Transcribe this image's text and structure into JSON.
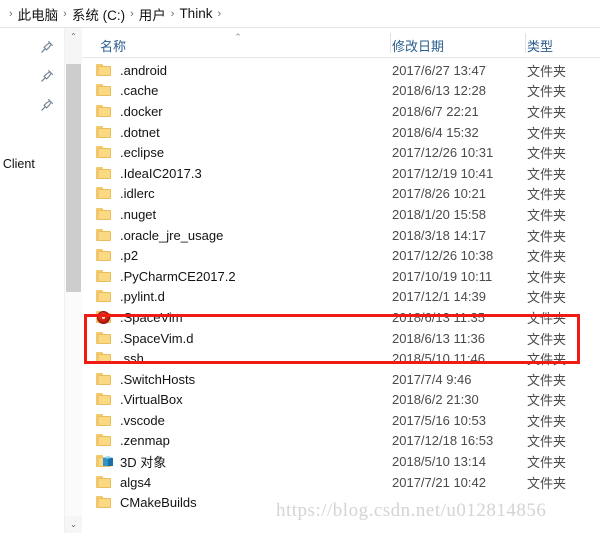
{
  "breadcrumb": {
    "separator": "›",
    "items": [
      "此电脑",
      "系统 (C:)",
      "用户",
      "Think"
    ],
    "trailing_separator": "›"
  },
  "nav_pane": {
    "pin_icon": "pin-icon",
    "partial_label": "ker Client"
  },
  "scrollbar": {
    "up_arrow": "⌃",
    "down_arrow": "⌄"
  },
  "columns": {
    "name": "名称",
    "date_modified": "修改日期",
    "type": "类型",
    "sort_indicator": "⌃"
  },
  "files": [
    {
      "icon": "folder-icon",
      "name": ".android",
      "date": "2017/6/27 13:47",
      "type": "文件夹"
    },
    {
      "icon": "folder-icon",
      "name": ".cache",
      "date": "2018/6/13 12:28",
      "type": "文件夹"
    },
    {
      "icon": "folder-icon",
      "name": ".docker",
      "date": "2018/6/7 22:21",
      "type": "文件夹"
    },
    {
      "icon": "folder-icon",
      "name": ".dotnet",
      "date": "2018/6/4 15:32",
      "type": "文件夹"
    },
    {
      "icon": "folder-icon",
      "name": ".eclipse",
      "date": "2017/12/26 10:31",
      "type": "文件夹"
    },
    {
      "icon": "folder-icon",
      "name": ".IdeaIC2017.3",
      "date": "2017/12/19 10:41",
      "type": "文件夹"
    },
    {
      "icon": "folder-icon",
      "name": ".idlerc",
      "date": "2017/8/26 10:21",
      "type": "文件夹"
    },
    {
      "icon": "folder-icon",
      "name": ".nuget",
      "date": "2018/1/20 15:58",
      "type": "文件夹"
    },
    {
      "icon": "folder-icon",
      "name": ".oracle_jre_usage",
      "date": "2018/3/18 14:17",
      "type": "文件夹"
    },
    {
      "icon": "folder-icon",
      "name": ".p2",
      "date": "2017/12/26 10:38",
      "type": "文件夹"
    },
    {
      "icon": "folder-icon",
      "name": ".PyCharmCE2017.2",
      "date": "2017/10/19 10:11",
      "type": "文件夹"
    },
    {
      "icon": "folder-icon",
      "name": ".pylint.d",
      "date": "2017/12/1 14:39",
      "type": "文件夹"
    },
    {
      "icon": "folder-red-icon",
      "name": ".SpaceVim",
      "date": "2018/6/13 11:35",
      "type": "文件夹"
    },
    {
      "icon": "folder-icon",
      "name": ".SpaceVim.d",
      "date": "2018/6/13 11:36",
      "type": "文件夹"
    },
    {
      "icon": "folder-icon",
      "name": ".ssh",
      "date": "2018/5/10 11:46",
      "type": "文件夹"
    },
    {
      "icon": "folder-icon",
      "name": ".SwitchHosts",
      "date": "2017/7/4 9:46",
      "type": "文件夹"
    },
    {
      "icon": "folder-icon",
      "name": ".VirtualBox",
      "date": "2018/6/2 21:30",
      "type": "文件夹"
    },
    {
      "icon": "folder-icon",
      "name": ".vscode",
      "date": "2017/5/16 10:53",
      "type": "文件夹"
    },
    {
      "icon": "folder-icon",
      "name": ".zenmap",
      "date": "2017/12/18 16:53",
      "type": "文件夹"
    },
    {
      "icon": "folder-cube-icon",
      "name": "3D 对象",
      "date": "2018/5/10 13:14",
      "type": "文件夹"
    },
    {
      "icon": "folder-icon",
      "name": "algs4",
      "date": "2017/7/21 10:42",
      "type": "文件夹"
    },
    {
      "icon": "folder-icon",
      "name": "CMakeBuilds",
      "date": "",
      "type": ""
    }
  ],
  "annotation": {
    "color": "#ee1c15",
    "highlighted_rows": [
      ".SpaceVim",
      ".SpaceVim.d"
    ]
  },
  "watermark": {
    "text": "https://blog.csdn.net/u012814856"
  }
}
